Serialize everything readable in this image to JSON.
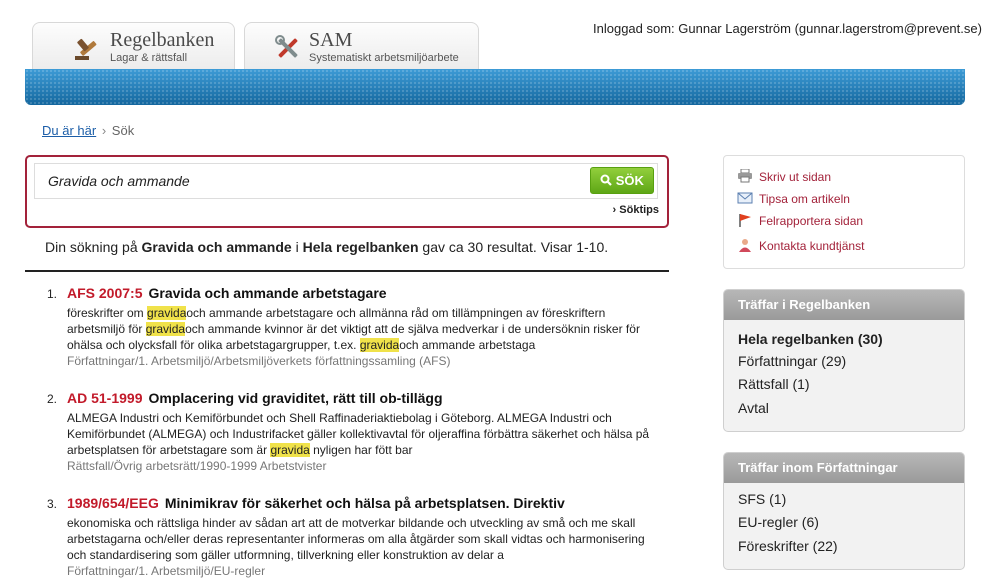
{
  "tabs": [
    {
      "title": "Regelbanken",
      "subtitle": "Lagar & rättsfall",
      "icon": "gavel-icon"
    },
    {
      "title": "SAM",
      "subtitle": "Systematiskt arbetsmiljöarbete",
      "icon": "tools-icon"
    }
  ],
  "login_text": "Inloggad som: Gunnar Lagerström (gunnar.lagerstrom@prevent.se)",
  "breadcrumb": {
    "link": "Du är här",
    "current": "Sök"
  },
  "search": {
    "value": "Gravida och ammande",
    "button": "SÖK",
    "tips": "› Söktips"
  },
  "summary": {
    "pre": "Din sökning på ",
    "query": "Gravida och ammande",
    "mid": " i ",
    "scope": "Hela regelbanken",
    "post": " gav ca 30 resultat. Visar 1-10."
  },
  "results": [
    {
      "num": "1.",
      "code": "AFS 2007:5",
      "title": "Gravida och ammande arbetstagare",
      "desc": [
        {
          "t": "föreskrifter om ",
          "h": false
        },
        {
          "t": "gravida",
          "h": true
        },
        {
          "t": "och ammande arbetstagare och allmänna råd om tillämpningen av föreskriftern arbetsmiljö för ",
          "h": false
        },
        {
          "t": "gravida",
          "h": true
        },
        {
          "t": "och ammande kvinnor är det viktigt att de själva medverkar i de undersöknin risker för ohälsa och olycksfall för olika arbetstagargrupper, t.ex. ",
          "h": false
        },
        {
          "t": "gravida",
          "h": true
        },
        {
          "t": "och ammande arbetstaga",
          "h": false
        }
      ],
      "path": "Författningar/1. Arbetsmiljö/Arbetsmiljöverkets författningssamling (AFS)"
    },
    {
      "num": "2.",
      "code": "AD 51-1999",
      "title": "Omplacering vid graviditet, rätt till ob-tillägg",
      "desc": [
        {
          "t": "ALMEGA Industri och Kemiförbundet och Shell Raffinaderiaktiebolag i Göteborg. ALMEGA Industri och Kemiförbundet (ALMEGA) och Industrifacket gäller kollektivavtal för oljeraffina förbättra säkerhet och hälsa på arbetsplatsen för arbetstagare som är ",
          "h": false
        },
        {
          "t": "gravida",
          "h": true
        },
        {
          "t": " nyligen har fött bar",
          "h": false
        }
      ],
      "path": "Rättsfall/Övrig arbetsrätt/1990-1999 Arbetstvister"
    },
    {
      "num": "3.",
      "code": "1989/654/EEG",
      "title": "Minimikrav för säkerhet och hälsa på arbetsplatsen. Direktiv",
      "desc": [
        {
          "t": "ekonomiska och rättsliga hinder av sådan art att de motverkar bildande och utveckling av små och me skall arbetstagarna och/eller deras representanter informeras om alla åtgärder som skall vidtas och harmonisering och standardisering som gäller utformning, tillverkning eller konstruktion av delar a",
          "h": false
        }
      ],
      "path": "Författningar/1. Arbetsmiljö/EU-regler"
    }
  ],
  "tools": [
    {
      "label": "Skriv ut sidan",
      "icon": "printer-icon"
    },
    {
      "label": "Tipsa om artikeln",
      "icon": "envelope-icon"
    },
    {
      "label": "Felrapportera sidan",
      "icon": "flag-icon"
    },
    {
      "label": "Kontakta kundtjänst",
      "icon": "person-icon"
    }
  ],
  "box1": {
    "title": "Träffar i Regelbanken",
    "items": [
      "Hela regelbanken (30)",
      "Författningar (29)",
      "Rättsfall (1)",
      "Avtal"
    ]
  },
  "box2": {
    "title": "Träffar inom Författningar",
    "items": [
      "SFS (1)",
      "EU-regler (6)",
      "Föreskrifter (22)"
    ]
  },
  "colors": {
    "accent": "#a3223a",
    "banner": "#1f7bb8",
    "search_button": "#6cb521",
    "highlight": "#f0e24a",
    "result_code": "#c21a2a"
  }
}
